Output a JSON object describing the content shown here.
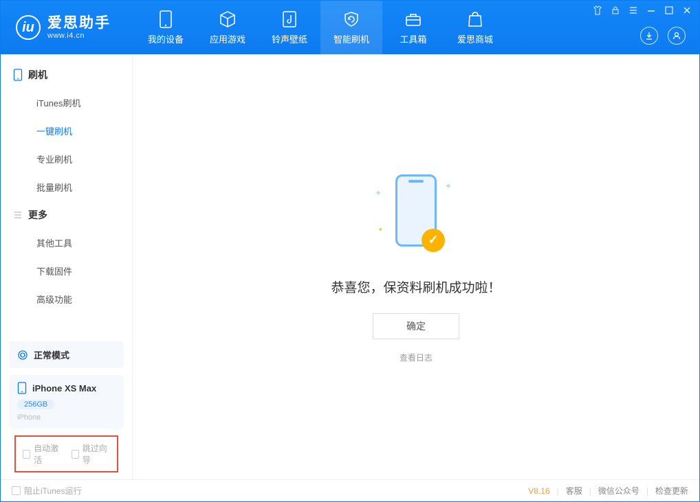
{
  "app": {
    "name": "爱思助手",
    "site": "www.i4.cn"
  },
  "nav": {
    "items": [
      {
        "label": "我的设备"
      },
      {
        "label": "应用游戏"
      },
      {
        "label": "铃声壁纸"
      },
      {
        "label": "智能刷机"
      },
      {
        "label": "工具箱"
      },
      {
        "label": "爱思商城"
      }
    ],
    "active_index": 3
  },
  "sidebar": {
    "group1_title": "刷机",
    "group1_items": [
      {
        "label": "iTunes刷机"
      },
      {
        "label": "一键刷机"
      },
      {
        "label": "专业刷机"
      },
      {
        "label": "批量刷机"
      }
    ],
    "group1_active_index": 1,
    "group2_title": "更多",
    "group2_items": [
      {
        "label": "其他工具"
      },
      {
        "label": "下载固件"
      },
      {
        "label": "高级功能"
      }
    ],
    "mode_label": "正常模式",
    "device_name": "iPhone XS Max",
    "device_storage": "256GB",
    "device_type": "iPhone",
    "auto_activate_label": "自动激活",
    "skip_guide_label": "跳过向导"
  },
  "main": {
    "success_text": "恭喜您，保资料刷机成功啦！",
    "ok_label": "确定",
    "log_label": "查看日志"
  },
  "footer": {
    "block_itunes_label": "阻止iTunes运行",
    "version": "V8.16",
    "links": [
      {
        "label": "客服"
      },
      {
        "label": "微信公众号"
      },
      {
        "label": "检查更新"
      }
    ]
  }
}
